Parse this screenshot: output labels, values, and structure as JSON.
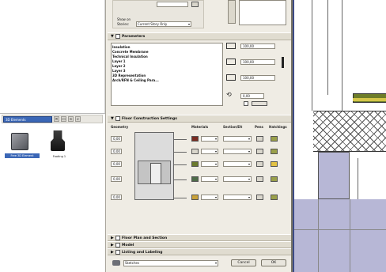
{
  "library": {
    "folder_label": "3D Elements",
    "items": [
      {
        "label": "Free 3D Element"
      },
      {
        "label": "Footing 1"
      }
    ]
  },
  "dialog": {
    "top": {
      "show_on_label": "Show on",
      "stories_label": "Stories:",
      "stories_value": "Current Story Only"
    },
    "parameters": {
      "title": "Parameters",
      "list": [
        "Insulation",
        "Concrete Membrane",
        "Technical Insulation",
        "Layer 1",
        "Layer 2",
        "Layer 3",
        "3D Representation",
        "Arch/RFN & Ceiling Para..."
      ],
      "fields": [
        "100,00",
        "100,00",
        "100,00",
        "0,00"
      ]
    },
    "floor_construction": {
      "title": "Floor Construction Settings",
      "geometry_label": "Geometry",
      "headers": [
        "Materials",
        "Section/Elt",
        "Pens",
        "Hatchings"
      ],
      "rows": [
        {
          "dim": "0,00",
          "swatch": "#7a2c22"
        },
        {
          "dim": "0,00",
          "swatch": "#d9d6cc"
        },
        {
          "dim": "0,00",
          "swatch": "#6b7a2e"
        },
        {
          "dim": "0,00",
          "swatch": "#4e6c4a"
        },
        {
          "dim": "0,00",
          "swatch": "#c9a23a"
        }
      ]
    },
    "collapsed_sections": [
      "Floor Plan and Section",
      "Model",
      "Listing and Labeling"
    ],
    "footer": {
      "layer_value": "Sketches",
      "cancel_label": "Cancel",
      "ok_label": "OK"
    }
  },
  "colors": {
    "selection": "#3b67b6",
    "dialog_bg": "#efece4",
    "plan_fill": "#b7b7d6"
  }
}
